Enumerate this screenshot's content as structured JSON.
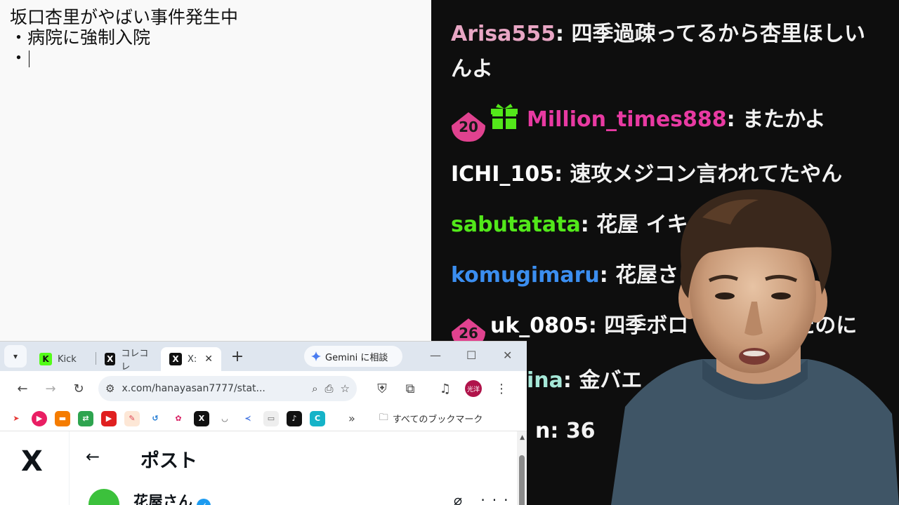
{
  "notepad": {
    "lines": [
      "坂口杏里がやばい事件発生中",
      "・病院に強制入院",
      "・"
    ]
  },
  "chat": {
    "messages": [
      {
        "user": "Arisa555",
        "sep": ": ",
        "text": "四季過疎ってるから杏里ほしいんよ",
        "color": "#e8a6c4"
      },
      {
        "badge": "20",
        "gift": true,
        "user": "Million_times888",
        "sep": ": ",
        "text": "またかよ",
        "color": "#e83aa2"
      },
      {
        "user": "ICHI_105",
        "sep": ": ",
        "text": "速攻メジコン言われてたやん",
        "color": "#ffffff"
      },
      {
        "user": "sabutatata",
        "sep": ": ",
        "text": "花屋 イキ",
        "color": "#52e81a"
      },
      {
        "user": "komugimaru",
        "sep": ": ",
        "text": "花屋さ",
        "color": "#3b8ef0"
      },
      {
        "badge": "26",
        "user": "uk_0805",
        "sep": ": ",
        "text": "四季ボロ　　　文句たのに",
        "color": "#ffffff"
      },
      {
        "user": "ina",
        "sep": ": ",
        "text": "金バエ",
        "color": "#a6e8d8"
      },
      {
        "user": "n",
        "sep": ": ",
        "text": "36",
        "color": "#ffffff"
      }
    ]
  },
  "browser": {
    "tabs": [
      {
        "label": "Kick",
        "icon": "K"
      },
      {
        "label": "コレコレ",
        "icon": "X"
      },
      {
        "label": "X:",
        "icon": "X",
        "active": true,
        "close": "✕"
      }
    ],
    "new_tab": "+",
    "gemini_label": "Gemini に相談",
    "win_min": "—",
    "win_max": "☐",
    "win_close": "✕",
    "url": "x.com/hanayasan7777/stat...",
    "avatar_text": "光洋",
    "bookmarks_more": "»",
    "bookmarks_folder": "すべてのブックマーク",
    "x_logo": "X",
    "back_arrow": "←",
    "page_title": "ポスト",
    "author": "花屋さん",
    "actions": "⌀ ···"
  },
  "colors": {
    "accent_pink": "#e0428f",
    "kick_green": "#53fc18",
    "x_blue": "#1d9bf0"
  }
}
